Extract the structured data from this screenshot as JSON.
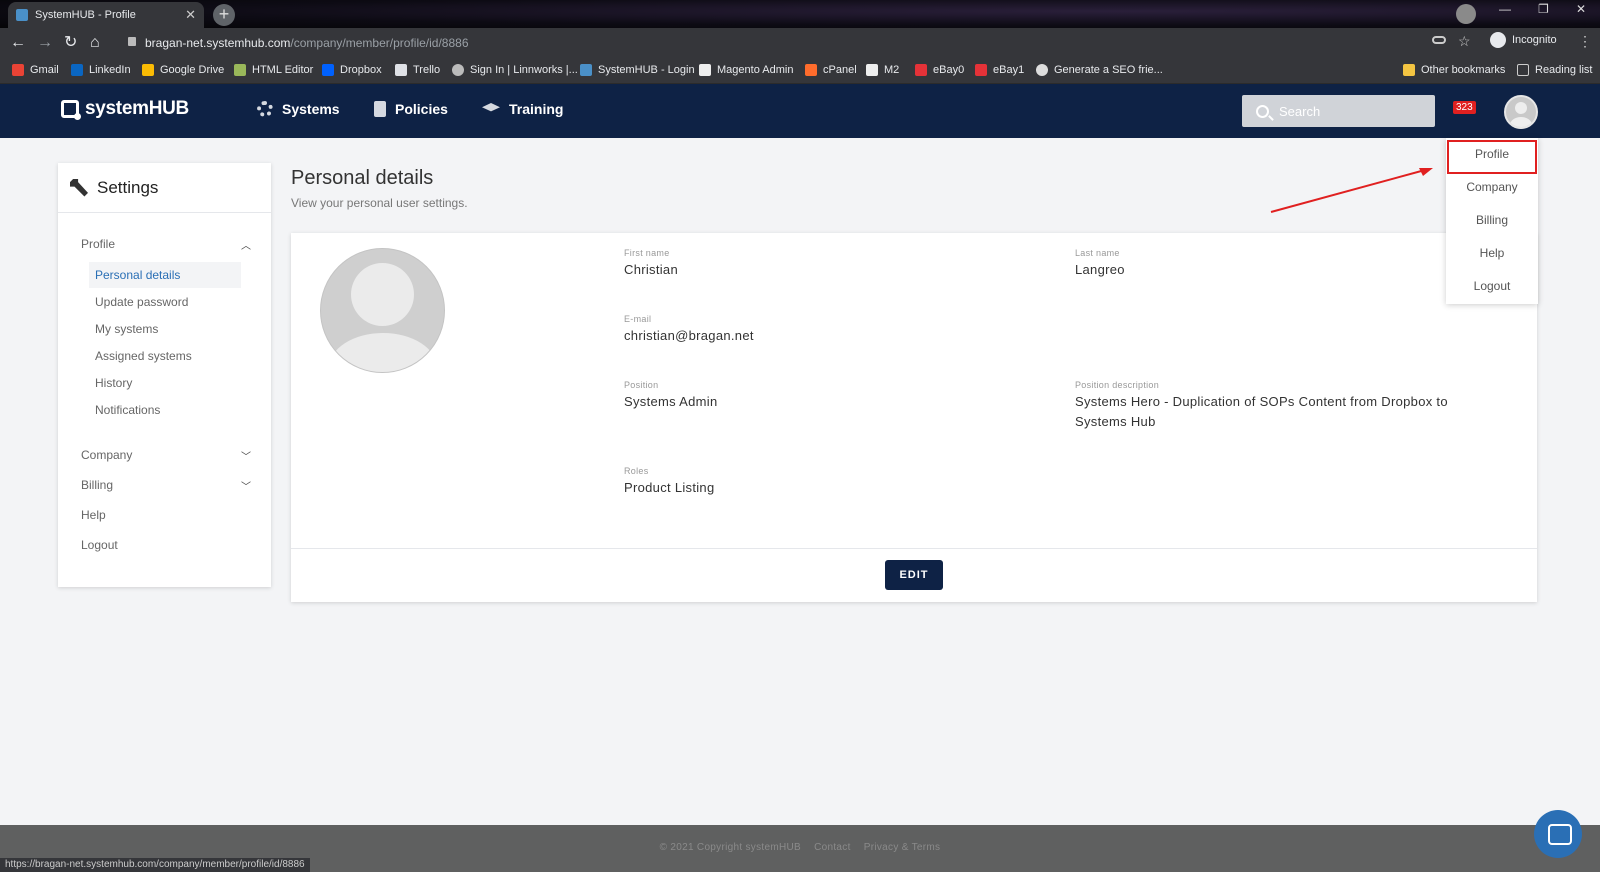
{
  "browser": {
    "tab_title": "SystemHUB - Profile",
    "url_host": "bragan-net.systemhub.com",
    "url_path": "/company/member/profile/id/8886",
    "incognito_label": "Incognito",
    "bookmarks": [
      "Gmail",
      "LinkedIn",
      "Google Drive",
      "HTML Editor",
      "Dropbox",
      "Trello",
      "Sign In | Linnworks |...",
      "SystemHUB - Login",
      "Magento Admin",
      "cPanel",
      "M2",
      "eBay0",
      "eBay1",
      "Generate a SEO frie..."
    ],
    "other_bookmarks": "Other bookmarks",
    "reading_list": "Reading list",
    "status_url": "https://bragan-net.systemhub.com/company/member/profile/id/8886"
  },
  "header": {
    "logo": "systemHUB",
    "nav": [
      "Systems",
      "Policies",
      "Training"
    ],
    "search_placeholder": "Search",
    "notification_count": "323"
  },
  "dropdown": [
    "Profile",
    "Company",
    "Billing",
    "Help",
    "Logout"
  ],
  "sidebar": {
    "title": "Settings",
    "profile": "Profile",
    "items": [
      "Personal details",
      "Update password",
      "My systems",
      "Assigned systems",
      "History",
      "Notifications"
    ],
    "company": "Company",
    "billing": "Billing",
    "help": "Help",
    "logout": "Logout"
  },
  "main": {
    "title": "Personal details",
    "subtitle": "View your personal user settings.",
    "first_name_label": "First name",
    "first_name": "Christian",
    "last_name_label": "Last name",
    "last_name": "Langreo",
    "email_label": "E-mail",
    "email": "christian@bragan.net",
    "position_label": "Position",
    "position": "Systems Admin",
    "position_desc_label": "Position description",
    "position_desc": "Systems Hero - Duplication of SOPs Content from Dropbox to Systems Hub",
    "roles_label": "Roles",
    "roles": "Product Listing",
    "edit_button": "EDIT"
  },
  "footer": {
    "copyright": "© 2021 Copyright systemHUB",
    "contact": "Contact",
    "privacy": "Privacy & Terms"
  },
  "colors": {
    "navy": "#0e2245",
    "accent": "#2a6fb5",
    "highlight_red": "#e02020"
  }
}
